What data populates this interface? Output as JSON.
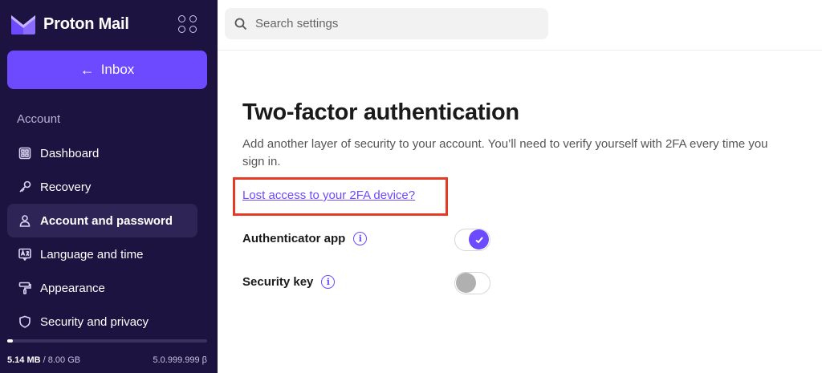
{
  "sidebar": {
    "brand": "Proton Mail",
    "inbox_button": "Inbox",
    "section_label": "Account",
    "items": [
      {
        "label": "Dashboard",
        "icon": "dashboard-icon"
      },
      {
        "label": "Recovery",
        "icon": "key-icon"
      },
      {
        "label": "Account and password",
        "icon": "user-icon",
        "active": true
      },
      {
        "label": "Language and time",
        "icon": "language-icon"
      },
      {
        "label": "Appearance",
        "icon": "paint-roller-icon"
      },
      {
        "label": "Security and privacy",
        "icon": "shield-icon"
      }
    ],
    "storage": {
      "used": "5.14 MB",
      "total": " / 8.00 GB",
      "fraction": 0.0006
    },
    "version": "5.0.999.999 β"
  },
  "search": {
    "placeholder": "Search settings"
  },
  "main": {
    "title": "Two-factor authentication",
    "description": "Add another layer of security to your account. You’ll need to verify yourself with 2FA every time you sign in.",
    "lost_link": "Lost access to your 2FA device?",
    "options": [
      {
        "label": "Authenticator app",
        "enabled": true
      },
      {
        "label": "Security key",
        "enabled": false
      }
    ]
  },
  "colors": {
    "accent": "#6d4aff",
    "sidebar_bg": "#1c1340",
    "highlight_box": "#e53b25"
  }
}
